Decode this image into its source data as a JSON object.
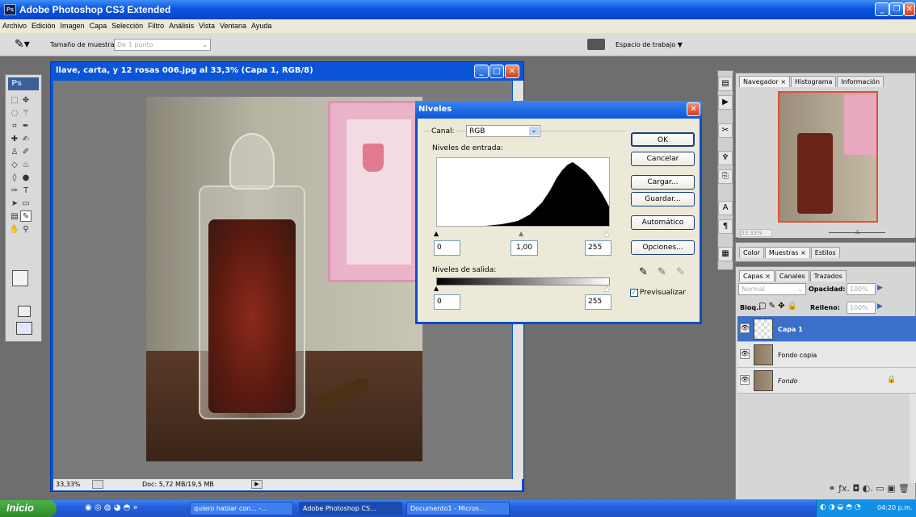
{
  "app": {
    "title": "Adobe Photoshop CS3 Extended",
    "logo": "Ps"
  },
  "menu": [
    "Archivo",
    "Edición",
    "Imagen",
    "Capa",
    "Selección",
    "Filtro",
    "Análisis",
    "Vista",
    "Ventana",
    "Ayuda"
  ],
  "options": {
    "sample_label": "Tamaño de muestra:",
    "sample_value": "De 1 punto",
    "workspace_label": "Espacio de trabajo ▼"
  },
  "document": {
    "title": "llave, carta, y 12 rosas 006.jpg al 33,3% (Capa 1, RGB/8)",
    "zoom": "33,33%",
    "doc_size": "Doc: 5,72 MB/19,5 MB"
  },
  "levels": {
    "title": "Niveles",
    "channel_label": "Canal:",
    "channel_value": "RGB",
    "input_label": "Niveles de entrada:",
    "input_black": "0",
    "input_gamma": "1,00",
    "input_white": "255",
    "output_label": "Niveles de salida:",
    "output_black": "0",
    "output_white": "255",
    "ok": "OK",
    "cancel": "Cancelar",
    "load": "Cargar...",
    "save": "Guardar...",
    "auto": "Automático",
    "options": "Opciones...",
    "preview_label": "Previsualizar",
    "preview_checked": true
  },
  "navigator": {
    "tabs": [
      "Navegador ×",
      "Histograma",
      "Información"
    ],
    "zoom": "33.33%"
  },
  "swatches": {
    "tabs": [
      "Color",
      "Muestras ×",
      "Estilos"
    ]
  },
  "layers_panel": {
    "tabs": [
      "Capas ×",
      "Canales",
      "Trazados"
    ],
    "blend_mode": "Normal",
    "opacity_label": "Opacidad:",
    "opacity_value": "100%",
    "lock_label": "Bloq.:",
    "fill_label": "Relleno:",
    "fill_value": "100%",
    "layers": [
      {
        "name": "Capa 1"
      },
      {
        "name": "Fondo copia"
      },
      {
        "name": "Fondo"
      }
    ]
  },
  "taskbar": {
    "start": "Inicio",
    "items": [
      "quiero hablar con... -...",
      "Adobe Photoshop CS...",
      "Documento1 - Micros..."
    ],
    "clock": "04:20 p.m."
  },
  "colors": {
    "xp_blue": "#0b55d8",
    "panel_gray": "#d6d6d6",
    "selection_blue": "#3b6fc9"
  }
}
